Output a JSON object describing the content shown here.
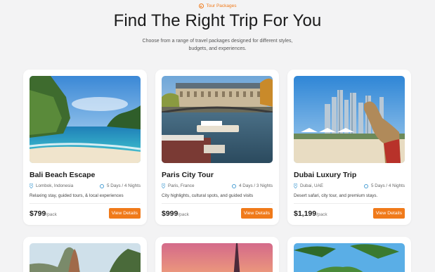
{
  "header": {
    "eyebrow": "Tour Packages",
    "title": "Find The Right Trip For You",
    "subtitle": "Choose from a range of travel packages designed for different styles, budgets, and experiences."
  },
  "colors": {
    "accent": "#f07a1a",
    "background": "#f3f3f4",
    "card": "#ffffff",
    "icon": "#4a9fd4"
  },
  "cards": [
    {
      "name": "Bali Beach Escape",
      "location": "Lombok, Indonesia",
      "duration": "5 Days / 4 Nights",
      "description": "Relaxing stay, guided tours, & local experiences",
      "price": "$799",
      "per": "/pack",
      "button": "View Details",
      "image": "beach-cliffs-photo"
    },
    {
      "name": "Paris City Tour",
      "location": "Paris, France",
      "duration": "4 Days / 3 Nights",
      "description": "City highlights, cultural spots, and guided visits",
      "price": "$999",
      "per": "/pack",
      "button": "View Details",
      "image": "paris-seine-photo"
    },
    {
      "name": "Dubai Luxury Trip",
      "location": "Dubai, UAE",
      "duration": "5 Days / 4 Nights",
      "description": "Desert safari, city tour, and premium stays.",
      "price": "$1,199",
      "per": "/pack",
      "button": "View Details",
      "image": "dubai-camel-photo"
    },
    {
      "image": "karst-cliffs-photo"
    },
    {
      "image": "eiffel-sunset-photo"
    },
    {
      "image": "palm-tropical-photo"
    }
  ]
}
